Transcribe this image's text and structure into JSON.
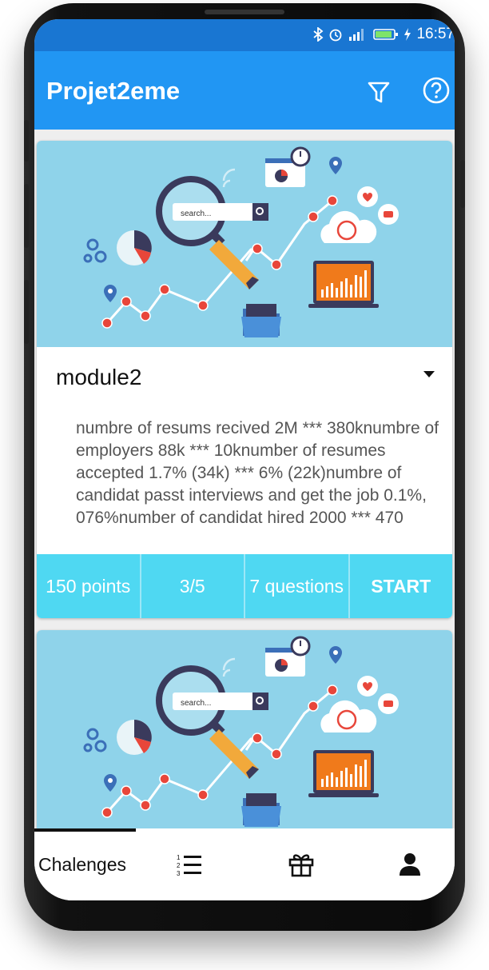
{
  "status_bar": {
    "time": "16:57"
  },
  "app_bar": {
    "title": "Projet2eme",
    "filter_icon": "filter-icon",
    "help_icon": "help-icon"
  },
  "cards": [
    {
      "title": "module2",
      "description": "numbre of resums recived  2M *** 380knumbre of employers  88k *** 10knumber of resumes accepted 1.7% (34k) *** 6% (22k)numbre of candidat passt interviews and get the job 0.1%, 076%number of candidat hired   2000 *** 470",
      "stats": {
        "points": "150 points",
        "progress": "3/5",
        "questions": "7 questions",
        "action": "START"
      }
    }
  ],
  "illustration": {
    "search_placeholder": "search..."
  },
  "bottom_nav": {
    "items": [
      {
        "label": "Chalenges",
        "active": true
      },
      {
        "icon": "ranking-list-icon"
      },
      {
        "icon": "gift-icon"
      },
      {
        "icon": "profile-icon"
      }
    ]
  },
  "colors": {
    "status_bar": "#1976d2",
    "app_bar": "#2196f3",
    "stats_bar": "#4fd8f2",
    "illustration_bg": "#8fd3ea"
  }
}
